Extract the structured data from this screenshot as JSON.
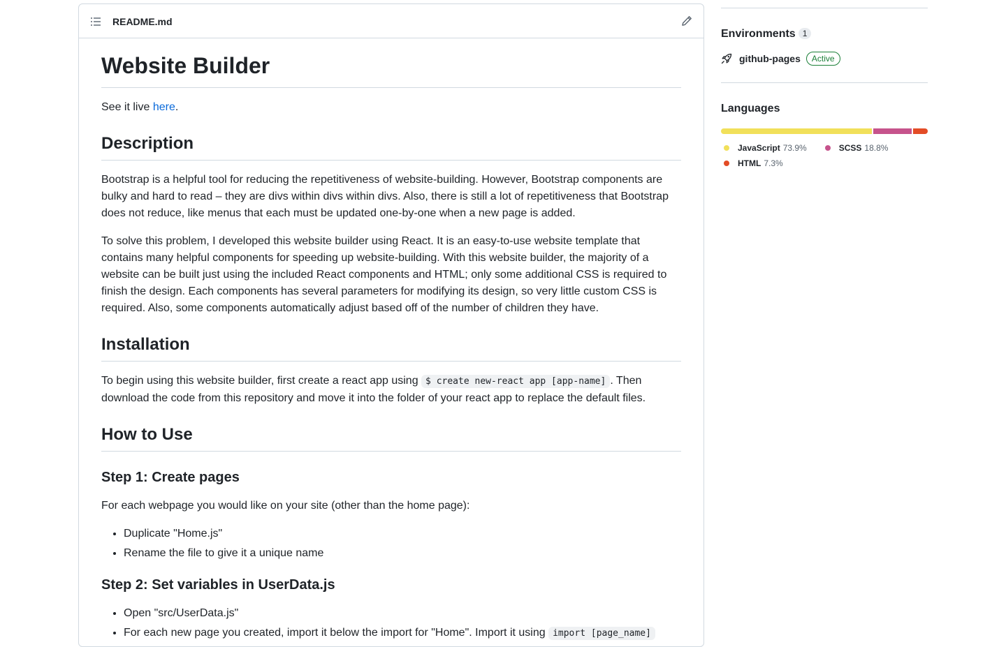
{
  "readme": {
    "filename": "README.md",
    "title": "Website Builder",
    "intro_prefix": "See it live ",
    "intro_link": "here",
    "intro_suffix": ".",
    "description_heading": "Description",
    "description_p1": "Bootstrap is a helpful tool for reducing the repetitiveness of website-building. However, Bootstrap components are bulky and hard to read – they are divs within divs within divs. Also, there is still a lot of repetitiveness that Bootstrap does not reduce, like menus that each must be updated one-by-one when a new page is added.",
    "description_p2": "To solve this problem, I developed this website builder using React. It is an easy-to-use website template that contains many helpful components for speeding up website-building. With this website builder, the majority of a website can be built just using the included React components and HTML; only some additional CSS is required to finish the design. Each components has several parameters for modifying its design, so very little custom CSS is required. Also, some components automatically adjust based off of the number of children they have.",
    "installation_heading": "Installation",
    "installation_prefix": "To begin using this website builder, first create a react app using ",
    "installation_code": "$ create new-react app [app-name]",
    "installation_suffix": ". Then download the code from this repository and move it into the folder of your react app to replace the default files.",
    "howto_heading": "How to Use",
    "step1_heading": "Step 1: Create pages",
    "step1_text": "For each webpage you would like on your site (other than the home page):",
    "step1_items": [
      "Duplicate \"Home.js\"",
      "Rename the file to give it a unique name"
    ],
    "step2_heading": "Step 2: Set variables in UserData.js",
    "step2_item1": "Open \"src/UserData.js\"",
    "step2_item2_prefix": "For each new page you created, import it below the import for \"Home\". Import it using ",
    "step2_item2_code": "import [page_name]"
  },
  "sidebar": {
    "environments_heading": "Environments",
    "environments_count": "1",
    "environment_name": "github-pages",
    "environment_status": "Active",
    "languages_heading": "Languages",
    "languages": [
      {
        "name": "JavaScript",
        "percent": "73.9%",
        "value": 73.9,
        "color": "#f1e05a"
      },
      {
        "name": "SCSS",
        "percent": "18.8%",
        "value": 18.8,
        "color": "#c6538c"
      },
      {
        "name": "HTML",
        "percent": "7.3%",
        "value": 7.3,
        "color": "#e34c26"
      }
    ]
  }
}
